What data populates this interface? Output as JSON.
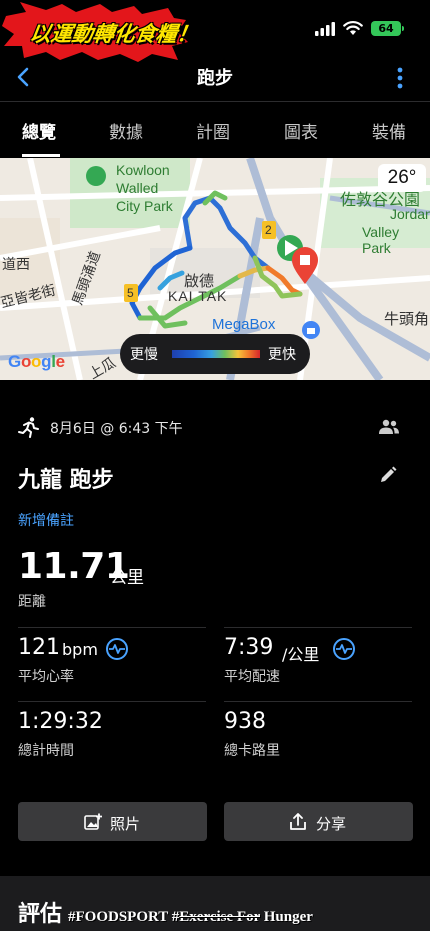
{
  "status_bar": {
    "sticker_text": "以運動轉化食糧！",
    "battery": "64",
    "icons": [
      "signal-icon",
      "wifi-icon",
      "battery-icon"
    ]
  },
  "nav": {
    "title": "跑步",
    "back_icon": "chevron-left-icon",
    "menu_icon": "kebab-menu-icon"
  },
  "tabs": [
    {
      "label": "總覽",
      "active": true
    },
    {
      "label": "數據",
      "active": false
    },
    {
      "label": "計圈",
      "active": false
    },
    {
      "label": "圖表",
      "active": false
    },
    {
      "label": "裝備",
      "active": false
    }
  ],
  "map": {
    "temperature": "26°",
    "labels": {
      "park1": "Kowloon",
      "park2": "Walled",
      "park3": "City Park",
      "district_cn": "啟德",
      "district_en": "KAI TAK",
      "road1": "道西",
      "road2": "亞皆老街",
      "road3": "馬頭涌道",
      "road4": "上瓜",
      "megabox": "MegaBox",
      "park_right_cn": "佐敦谷公園",
      "park_right_en1": "Jordan",
      "park_right_en2": "Valley Park",
      "place_right": "牛頭角",
      "marker_2": "2",
      "marker_5": "5"
    },
    "attribution": "Google",
    "legend": {
      "slow": "更慢",
      "fast": "更快"
    },
    "colors": {
      "route_slow": "#1f64d4",
      "route_mid": "#6fc05e",
      "route_fast": "#f07a2a",
      "start": "#34a853",
      "end": "#ea4335"
    }
  },
  "activity": {
    "datetime": "8月6日 @ 6:43 下午",
    "title": "九龍 跑步",
    "add_note": "新增備註",
    "distance": {
      "value": "11.71",
      "unit": "公里",
      "label": "距離"
    },
    "stats": [
      {
        "value": "121",
        "unit": "bpm",
        "label": "平均心率",
        "has_icon": true
      },
      {
        "value": "7:39",
        "unit": "/公里",
        "label": "平均配速",
        "has_icon": true
      },
      {
        "value": "1:29:32",
        "unit": "",
        "label": "總計時間",
        "has_icon": false
      },
      {
        "value": "938",
        "unit": "",
        "label": "總卡路里",
        "has_icon": false
      }
    ],
    "buttons": {
      "photo": "照片",
      "share": "分享"
    }
  },
  "evaluation": {
    "title": "評估"
  },
  "watermark": {
    "part1": "#FOODSPORT #",
    "part2": "Exercise For",
    "part3": " Hunger"
  },
  "colors": {
    "accent": "#4aa3ff",
    "background": "#000000",
    "card": "#1c1c1e",
    "button": "#3a3a3c"
  }
}
